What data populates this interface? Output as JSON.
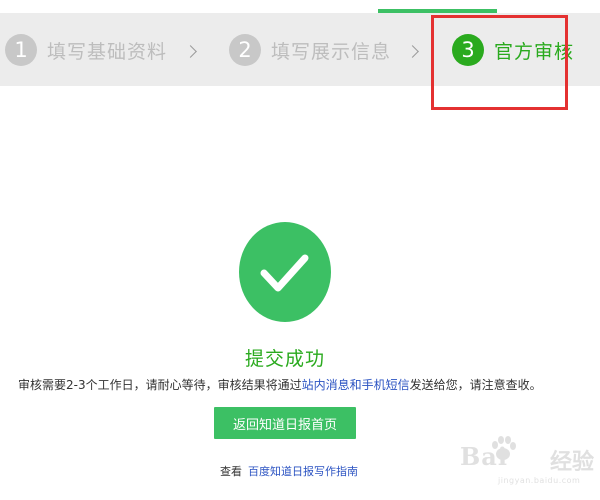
{
  "steps": [
    {
      "number": "1",
      "label": "填写基础资料",
      "status": "inactive"
    },
    {
      "number": "2",
      "label": "填写展示信息",
      "status": "inactive"
    },
    {
      "number": "3",
      "label": "官方审核",
      "status": "active"
    }
  ],
  "step_separator_icon": "chevron-right-icon",
  "success": {
    "icon": "checkmark-icon",
    "title": "提交成功",
    "desc_before": "审核需要2-3个工作日，请耐心等待，审核结果将通过",
    "desc_link": "站内消息和手机短信",
    "desc_after": "发送给您，请注意查收。"
  },
  "return_button": "返回知道日报首页",
  "guide": {
    "prefix": "查看",
    "link": "百度知道日报写作指南"
  },
  "watermark": {
    "text": "Bai",
    "suffix": "经验",
    "url": "jingyan.baidu.com"
  },
  "colors": {
    "accent_green": "#3cc064",
    "active_step_green": "#2aaa1e",
    "highlight_red": "#e43131",
    "link_blue": "#2b53c2"
  }
}
